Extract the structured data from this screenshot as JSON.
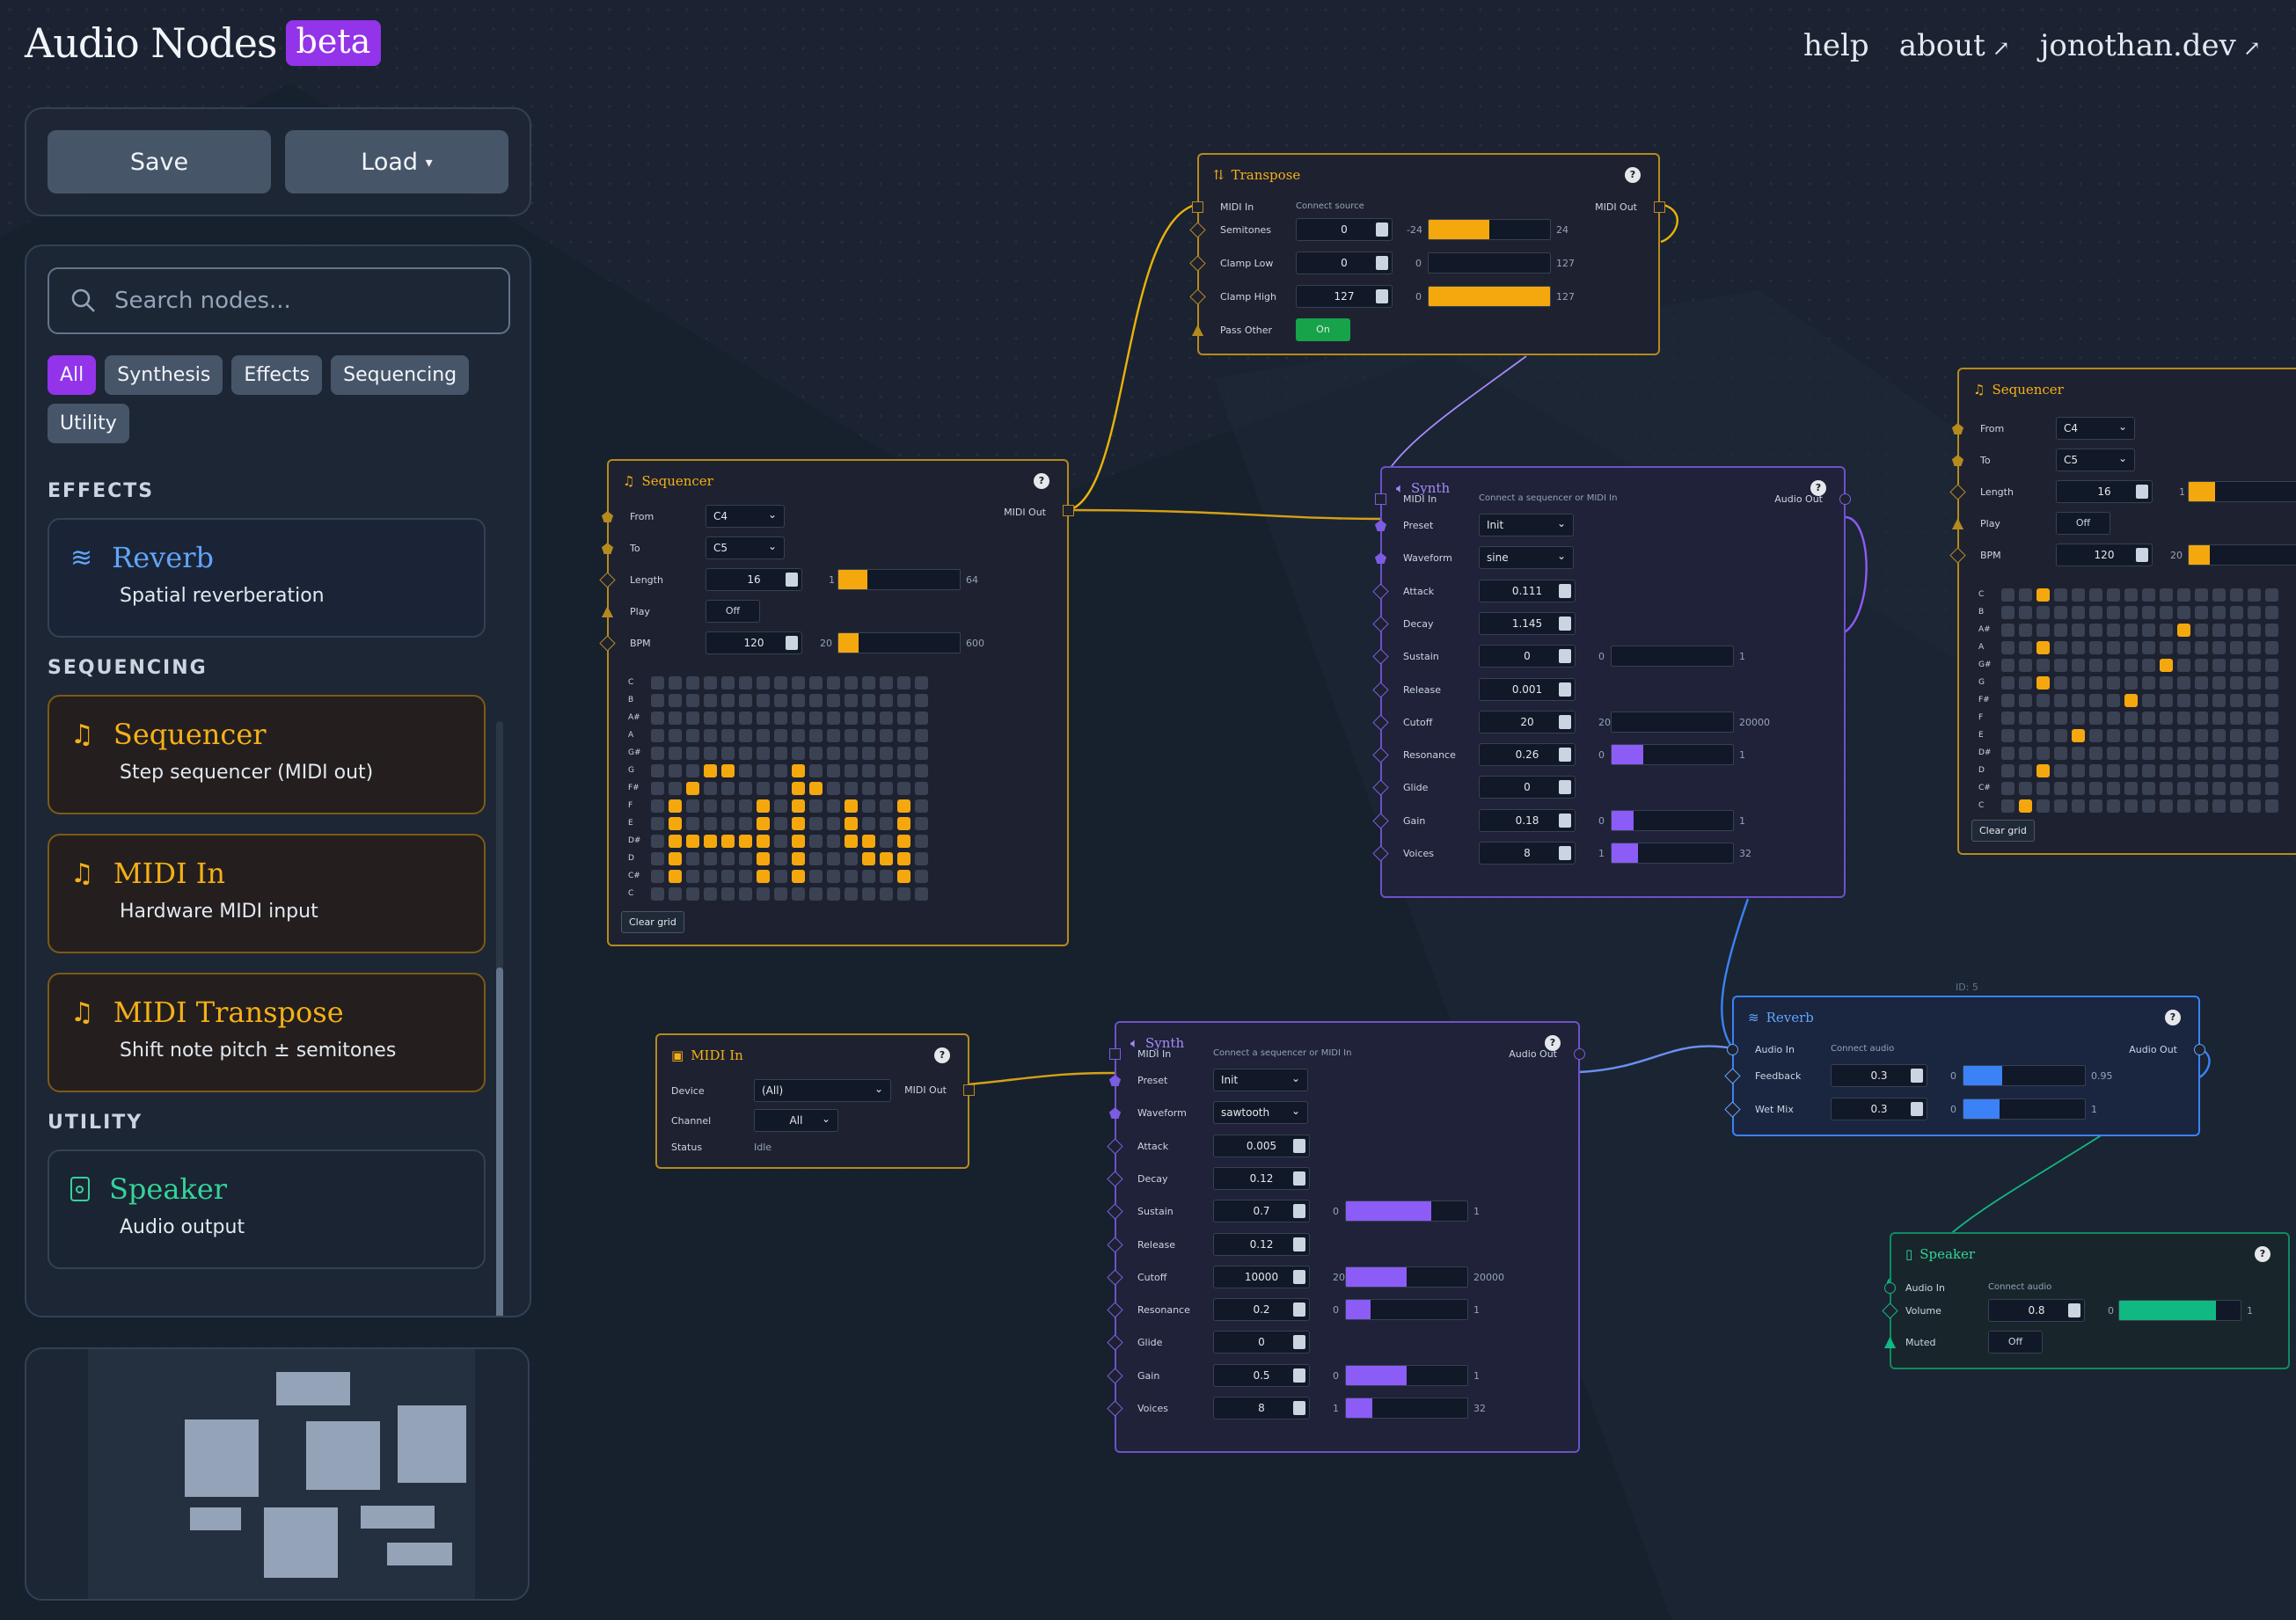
{
  "header": {
    "title": "Audio Nodes",
    "badge": "beta",
    "nav": [
      {
        "label": "help",
        "external": false
      },
      {
        "label": "about",
        "external": true
      },
      {
        "label": "jonothan.dev",
        "external": true
      }
    ]
  },
  "toolbar": {
    "save_label": "Save",
    "load_label": "Load",
    "load_caret": "▾"
  },
  "library": {
    "search_placeholder": "Search nodes...",
    "filters": [
      "All",
      "Synthesis",
      "Effects",
      "Sequencing",
      "Utility"
    ],
    "active_filter": "All",
    "sections": [
      {
        "heading": "EFFECTS",
        "items": [
          {
            "name": "Reverb",
            "desc": "Spatial reverberation",
            "icon": "waves-icon"
          }
        ]
      },
      {
        "heading": "SEQUENCING",
        "items": [
          {
            "name": "Sequencer",
            "desc": "Step sequencer (MIDI out)",
            "icon": "music-note-icon"
          },
          {
            "name": "MIDI In",
            "desc": "Hardware MIDI input",
            "icon": "music-note-icon"
          },
          {
            "name": "MIDI Transpose",
            "desc": "Shift note pitch ± semitones",
            "icon": "music-note-icon"
          }
        ]
      },
      {
        "heading": "UTILITY",
        "items": [
          {
            "name": "Speaker",
            "desc": "Audio output",
            "icon": "speaker-icon"
          }
        ]
      }
    ]
  },
  "colors": {
    "sequencing": "#f5b017",
    "synth": "#8b5cf6",
    "effects": "#3b82f6",
    "utility": "#10b981",
    "accent": "#9333ea"
  },
  "nodes": {
    "transpose": {
      "title": "Transpose",
      "in": "MIDI In",
      "hint": "Connect source",
      "out": "MIDI Out",
      "semitones": {
        "label": "Semitones",
        "value": "0",
        "min": "-24",
        "max": "24",
        "level": 0.5
      },
      "clamp_low": {
        "label": "Clamp Low",
        "value": "0",
        "min": "0",
        "max": "127",
        "level": 0
      },
      "clamp_high": {
        "label": "Clamp High",
        "value": "127",
        "min": "0",
        "max": "127",
        "level": 1
      },
      "pass_other": {
        "label": "Pass Other",
        "value": "On"
      }
    },
    "seq1": {
      "title": "Sequencer",
      "out": "MIDI Out",
      "from": {
        "label": "From",
        "value": "C4"
      },
      "to": {
        "label": "To",
        "value": "C5"
      },
      "length": {
        "label": "Length",
        "value": "16",
        "min": "1",
        "max": "64",
        "level": 0.24
      },
      "play": {
        "label": "Play",
        "value": "Off"
      },
      "bpm": {
        "label": "BPM",
        "value": "120",
        "min": "20",
        "max": "600",
        "level": 0.17
      },
      "notes": [
        "C",
        "B",
        "A#",
        "A",
        "G#",
        "G",
        "F#",
        "F",
        "E",
        "D#",
        "D",
        "C#",
        "C"
      ],
      "grid": [
        "................",
        "................",
        "................",
        "................",
        "................",
        "...XX...X.......",
        "..X.....XX......",
        ".X....X.X..X..X.",
        ".X....X.X..X..X.",
        ".XXXXXX.X..XX.X.",
        ".X....X.X...XXX.",
        ".X....X.X.....X.",
        "................"
      ],
      "clear": "Clear grid"
    },
    "seq2": {
      "title": "Sequencer",
      "from": {
        "label": "From",
        "value": "C4"
      },
      "to": {
        "label": "To",
        "value": "C5"
      },
      "length": {
        "label": "Length",
        "value": "16",
        "min": "1"
      },
      "play": {
        "label": "Play",
        "value": "Off"
      },
      "bpm": {
        "label": "BPM",
        "value": "120",
        "min": "20"
      },
      "notes": [
        "C",
        "B",
        "A#",
        "A",
        "G#",
        "G",
        "F#",
        "F",
        "E",
        "D#",
        "D",
        "C#",
        "C"
      ],
      "grid": [
        "..X.............",
        "................",
        "..........X.....",
        "..X.............",
        ".........X......",
        "..X.............",
        ".......X........",
        "................",
        "....X...........",
        "................",
        "..X.............",
        "................",
        ".X.............."
      ],
      "clear": "Clear grid"
    },
    "synth1": {
      "title": "Synth",
      "in": "MIDI In",
      "hint": "Connect a sequencer or MIDI In",
      "out": "Audio Out",
      "preset": {
        "label": "Preset",
        "value": "Init"
      },
      "waveform": {
        "label": "Waveform",
        "value": "sine"
      },
      "attack": {
        "label": "Attack",
        "value": "0.111"
      },
      "decay": {
        "label": "Decay",
        "value": "1.145"
      },
      "sustain": {
        "label": "Sustain",
        "value": "0",
        "min": "0",
        "max": "1",
        "level": 0
      },
      "release": {
        "label": "Release",
        "value": "0.001"
      },
      "cutoff": {
        "label": "Cutoff",
        "value": "20",
        "min": "20",
        "max": "20000",
        "level": 0
      },
      "resonance": {
        "label": "Resonance",
        "value": "0.26",
        "min": "0",
        "max": "1",
        "level": 0.26
      },
      "glide": {
        "label": "Glide",
        "value": "0"
      },
      "gain": {
        "label": "Gain",
        "value": "0.18",
        "min": "0",
        "max": "1",
        "level": 0.18
      },
      "voices": {
        "label": "Voices",
        "value": "8",
        "min": "1",
        "max": "32",
        "level": 0.22
      }
    },
    "synth2": {
      "title": "Synth",
      "in": "MIDI In",
      "hint": "Connect a sequencer or MIDI In",
      "out": "Audio Out",
      "preset": {
        "label": "Preset",
        "value": "Init"
      },
      "waveform": {
        "label": "Waveform",
        "value": "sawtooth"
      },
      "attack": {
        "label": "Attack",
        "value": "0.005"
      },
      "decay": {
        "label": "Decay",
        "value": "0.12"
      },
      "sustain": {
        "label": "Sustain",
        "value": "0.7",
        "min": "0",
        "max": "1",
        "level": 0.7
      },
      "release": {
        "label": "Release",
        "value": "0.12"
      },
      "cutoff": {
        "label": "Cutoff",
        "value": "10000",
        "min": "20",
        "max": "20000",
        "level": 0.5
      },
      "resonance": {
        "label": "Resonance",
        "value": "0.2",
        "min": "0",
        "max": "1",
        "level": 0.2
      },
      "glide": {
        "label": "Glide",
        "value": "0"
      },
      "gain": {
        "label": "Gain",
        "value": "0.5",
        "min": "0",
        "max": "1",
        "level": 0.5
      },
      "voices": {
        "label": "Voices",
        "value": "8",
        "min": "1",
        "max": "32",
        "level": 0.22
      }
    },
    "midiin": {
      "title": "MIDI In",
      "out": "MIDI Out",
      "device": {
        "label": "Device",
        "value": "(All)"
      },
      "channel": {
        "label": "Channel",
        "value": "All"
      },
      "status": {
        "label": "Status",
        "value": "Idle"
      }
    },
    "reverb": {
      "title": "Reverb",
      "id_label": "ID: 5",
      "in": "Audio In",
      "hint": "Connect audio",
      "out": "Audio Out",
      "feedback": {
        "label": "Feedback",
        "value": "0.3",
        "min": "0",
        "max": "0.95",
        "level": 0.32
      },
      "wetmix": {
        "label": "Wet Mix",
        "value": "0.3",
        "min": "0",
        "max": "1",
        "level": 0.3
      }
    },
    "speaker": {
      "title": "Speaker",
      "in": "Audio In",
      "hint": "Connect audio",
      "volume": {
        "label": "Volume",
        "value": "0.8",
        "min": "0",
        "max": "1",
        "level": 0.8
      },
      "muted": {
        "label": "Muted",
        "value": "Off"
      }
    }
  }
}
